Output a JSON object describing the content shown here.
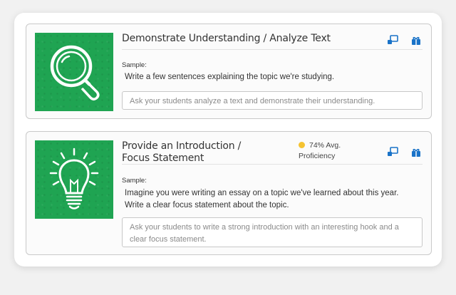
{
  "accent": "#1fa452",
  "icon_color": "#1a73c8",
  "cards": [
    {
      "title": "Demonstrate Understanding / Analyze Text",
      "image_icon": "magnifying-glass-icon",
      "sample_label": "Sample:",
      "sample_text": "Write a few sentences explaining the topic we're studying.",
      "prompt_text": "Ask your students analyze a text and demonstrate their understanding.",
      "tools": [
        "assign-icon",
        "gift-icon"
      ]
    },
    {
      "title": "Provide an Introduction / Focus Statement",
      "image_icon": "lightbulb-icon",
      "proficiency": {
        "value": "74% Avg.",
        "label": "Proficiency",
        "color": "#f5c331"
      },
      "sample_label": "Sample:",
      "sample_text": "Imagine you were writing an essay on a topic we've learned about this year. Write a clear focus statement about the topic.",
      "prompt_text": "Ask your students to write a strong introduction with an interesting hook and a clear focus statement.",
      "tools": [
        "assign-icon",
        "gift-icon"
      ]
    }
  ]
}
